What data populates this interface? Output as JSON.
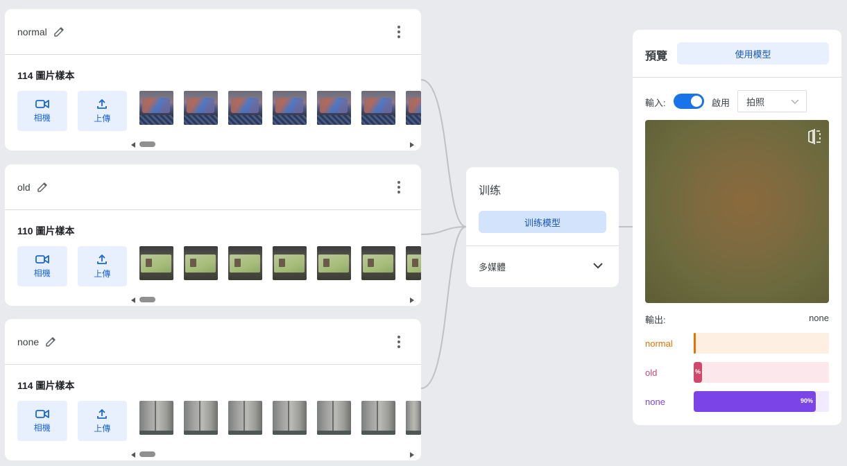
{
  "classes": [
    {
      "name": "normal",
      "sample_count": "114 圖片樣本",
      "camera_label": "相機",
      "upload_label": "上傳",
      "thumbnails": [
        "normal-sample",
        "normal-sample",
        "normal-sample",
        "normal-sample",
        "normal-sample",
        "normal-sample",
        "normal-sample"
      ]
    },
    {
      "name": "old",
      "sample_count": "110 圖片樣本",
      "camera_label": "相機",
      "upload_label": "上傳",
      "thumbnails": [
        "old-sample",
        "old-sample",
        "old-sample",
        "old-sample",
        "old-sample",
        "old-sample",
        "old-sample"
      ]
    },
    {
      "name": "none",
      "sample_count": "114 圖片樣本",
      "camera_label": "相機",
      "upload_label": "上傳",
      "thumbnails": [
        "none-sample",
        "none-sample",
        "none-sample",
        "none-sample",
        "none-sample",
        "none-sample",
        "none-sample"
      ]
    }
  ],
  "training": {
    "title": "训练",
    "train_button": "训练模型",
    "advanced_label": "多媒體"
  },
  "preview": {
    "title": "預覽",
    "export_button": "使用模型",
    "input_label": "輸入:",
    "toggle_label": "啟用",
    "toggle_on": true,
    "source_select": "拍照",
    "output_label": "輸出:",
    "output_value": "none",
    "confidences": [
      {
        "name": "normal",
        "fraction": 0.01,
        "pct_label": "",
        "color": "#e37400",
        "track_color": "#feefe3"
      },
      {
        "name": "old",
        "fraction": 0.06,
        "pct_label": "%",
        "color": "#d0466c",
        "track_color": "#fce8ec"
      },
      {
        "name": "none",
        "fraction": 0.9,
        "pct_label": "90%",
        "color": "#7b44e6",
        "track_color": "#f1ebfd"
      }
    ]
  },
  "colors": {
    "accent": "#1a73e8",
    "button_bg": "#e8f0fe",
    "connector": "#bdc1c6"
  }
}
